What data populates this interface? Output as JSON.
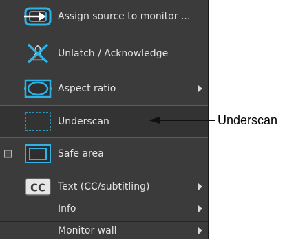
{
  "menu": {
    "items": [
      {
        "label": "Assign source to monitor ...",
        "icon": "assign-source-icon",
        "submenu": false
      },
      {
        "label": "Unlatch / Acknowledge",
        "icon": "unlatch-acknowledge-icon",
        "submenu": false
      },
      {
        "label": "Aspect ratio",
        "icon": "aspect-ratio-icon",
        "submenu": true
      },
      {
        "label": "Underscan",
        "icon": "underscan-icon",
        "submenu": false
      },
      {
        "label": "Safe area",
        "icon": "safe-area-icon",
        "submenu": false,
        "checkbox": true,
        "checked": false
      },
      {
        "label": "Text (CC/subtitling)",
        "icon": "cc-icon",
        "icon_text": "CC",
        "submenu": true
      },
      {
        "label": "Info",
        "submenu": true
      },
      {
        "label": "Monitor wall",
        "submenu": true
      }
    ]
  },
  "callout": {
    "label": "Underscan"
  },
  "colors": {
    "menu_bg": "#3b3b3b",
    "icon_accent": "#2fb3e6",
    "text": "#e2e2e2"
  }
}
